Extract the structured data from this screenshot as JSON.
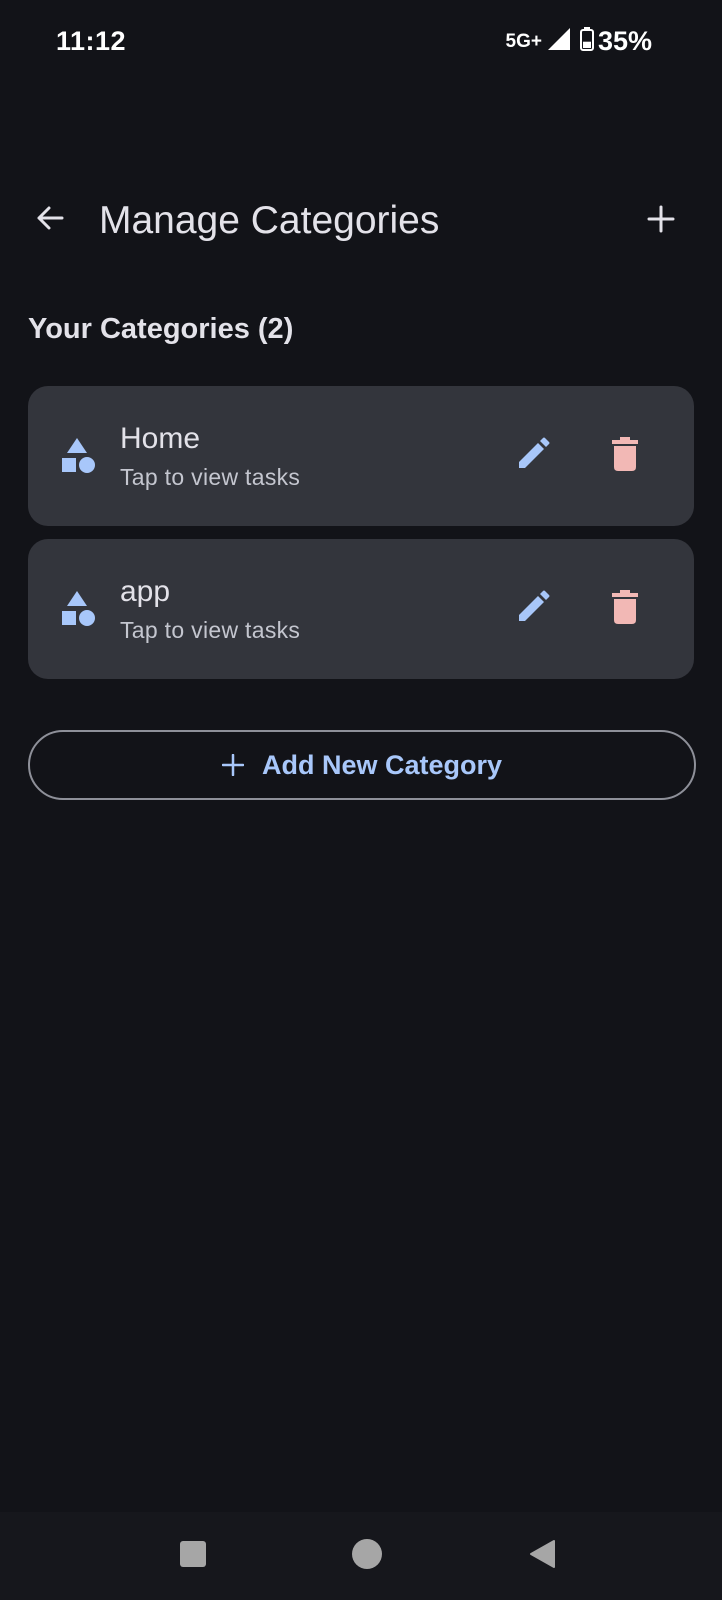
{
  "status_bar": {
    "time": "11:12",
    "network": "5G+",
    "battery": "35%",
    "battery_level": 0.35
  },
  "header": {
    "title": "Manage Categories",
    "back_icon": "arrow-back-icon",
    "add_icon": "plus-icon"
  },
  "section": {
    "title": "Your Categories (2)"
  },
  "categories": [
    {
      "name": "Home",
      "subtitle": "Tap to view tasks",
      "icon": "category-shapes-icon"
    },
    {
      "name": "app",
      "subtitle": "Tap to view tasks",
      "icon": "category-shapes-icon"
    }
  ],
  "add_new": {
    "label": "Add New Category",
    "icon": "plus-icon"
  },
  "nav": {
    "recents_icon": "square-icon",
    "home_icon": "circle-icon",
    "back_icon": "triangle-back-icon"
  },
  "colors": {
    "background": "#121318",
    "card": "#33353c",
    "accent": "#a8c7fa",
    "delete": "#f2b8b5",
    "text_primary": "#e3e2e9",
    "text_secondary": "#c4c6cf"
  }
}
